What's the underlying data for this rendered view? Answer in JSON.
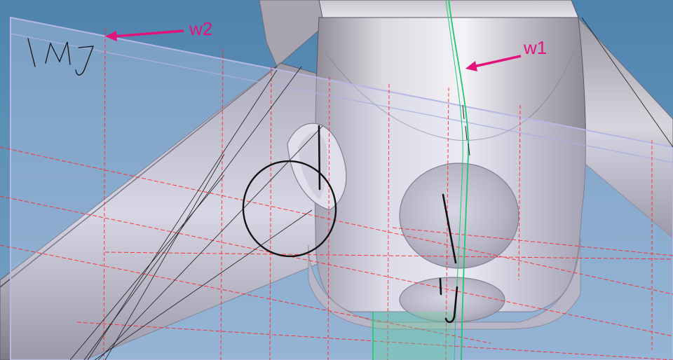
{
  "viewport": {
    "background_color": "#5f8fb8",
    "part_color": "#c9c6cf",
    "plane_color": "#d7d9f2",
    "construction_line_color": "#ff2a2a",
    "wire_w1_color": "#1fc86e",
    "annotation_color": "#e0147a",
    "sketch_color": "#111111"
  },
  "annotations": [
    {
      "id": "w2",
      "text": "w2",
      "arrow_color": "#e0147a"
    },
    {
      "id": "w1",
      "text": "w1",
      "arrow_color": "#e0147a"
    }
  ],
  "sketch_marks": [
    {
      "id": "handwritten-mark",
      "text": "\\MJ"
    }
  ]
}
